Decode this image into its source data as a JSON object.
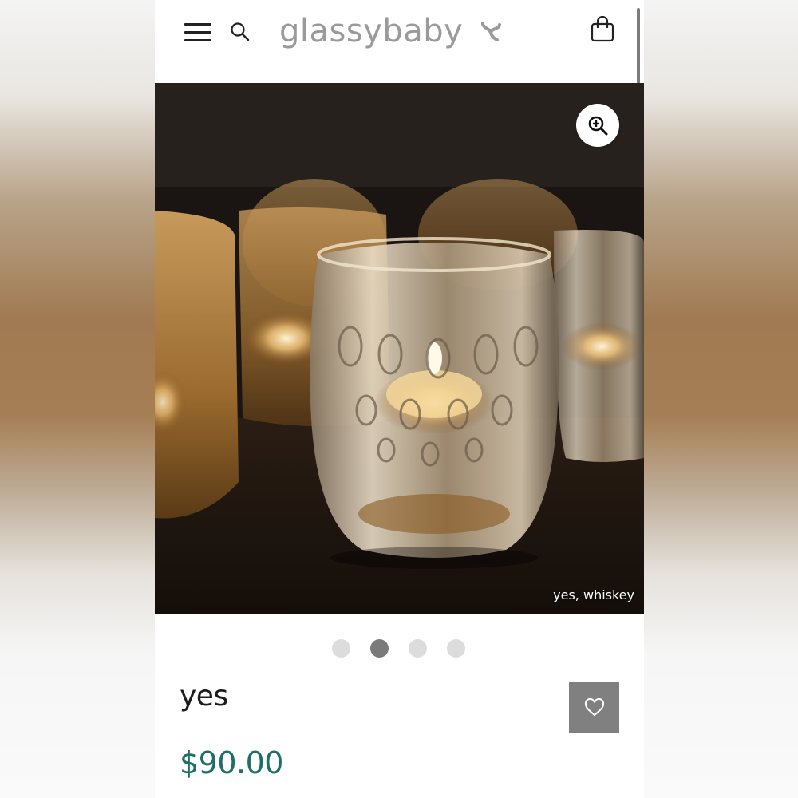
{
  "header": {
    "logo_text": "glassybaby",
    "menu_icon": "hamburger-menu-icon",
    "search_icon": "search-icon",
    "logo_mark_icon": "glassybaby-logo-mark-icon",
    "cart_icon": "shopping-bag-icon"
  },
  "hero": {
    "zoom_icon": "zoom-in-icon",
    "caption": "yes, whiskey"
  },
  "carousel": {
    "count": 4,
    "active_index": 1
  },
  "product": {
    "name": "yes",
    "price": "$90.00",
    "wishlist_icon": "heart-icon"
  },
  "colors": {
    "price": "#1f6e6a",
    "logo": "#9a9a9a",
    "wishlist_button": "#808080",
    "dot_active": "#7a7a7a",
    "dot_inactive": "#dcdcdc"
  }
}
